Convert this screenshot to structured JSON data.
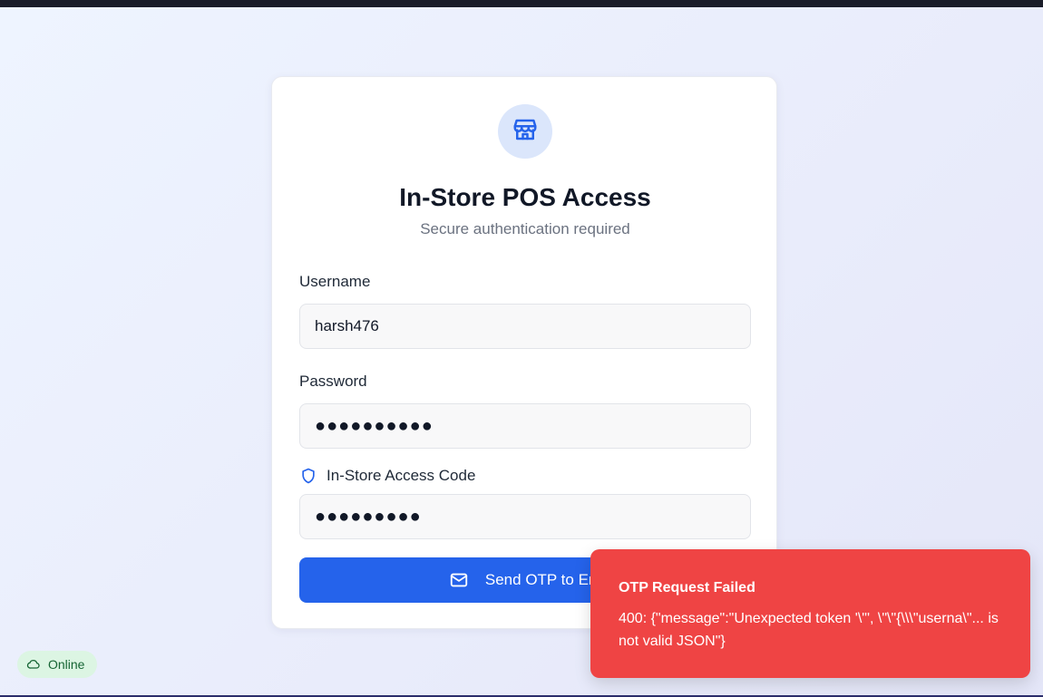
{
  "card": {
    "title": "In-Store POS Access",
    "subtitle": "Secure authentication required",
    "icon": "store-icon"
  },
  "form": {
    "username_label": "Username",
    "username_value": "harsh476",
    "password_label": "Password",
    "password_value": "●●●●●●●●●●",
    "access_code_label": "In-Store Access Code",
    "access_code_icon": "shield-icon",
    "access_code_value": "●●●●●●●●●",
    "send_button_label": "Send OTP to Em",
    "send_button_icon": "mail-icon"
  },
  "toast": {
    "title": "OTP Request Failed",
    "message": "400: {\"message\":\"Unexpected token '\\\"', \\\"\\\"{\\\\\\\"userna\\\"... is not valid JSON\"}"
  },
  "status": {
    "label": "Online",
    "icon": "cloud-icon",
    "color": "#166534"
  },
  "colors": {
    "accent": "#2563eb",
    "error": "#ef4444"
  }
}
